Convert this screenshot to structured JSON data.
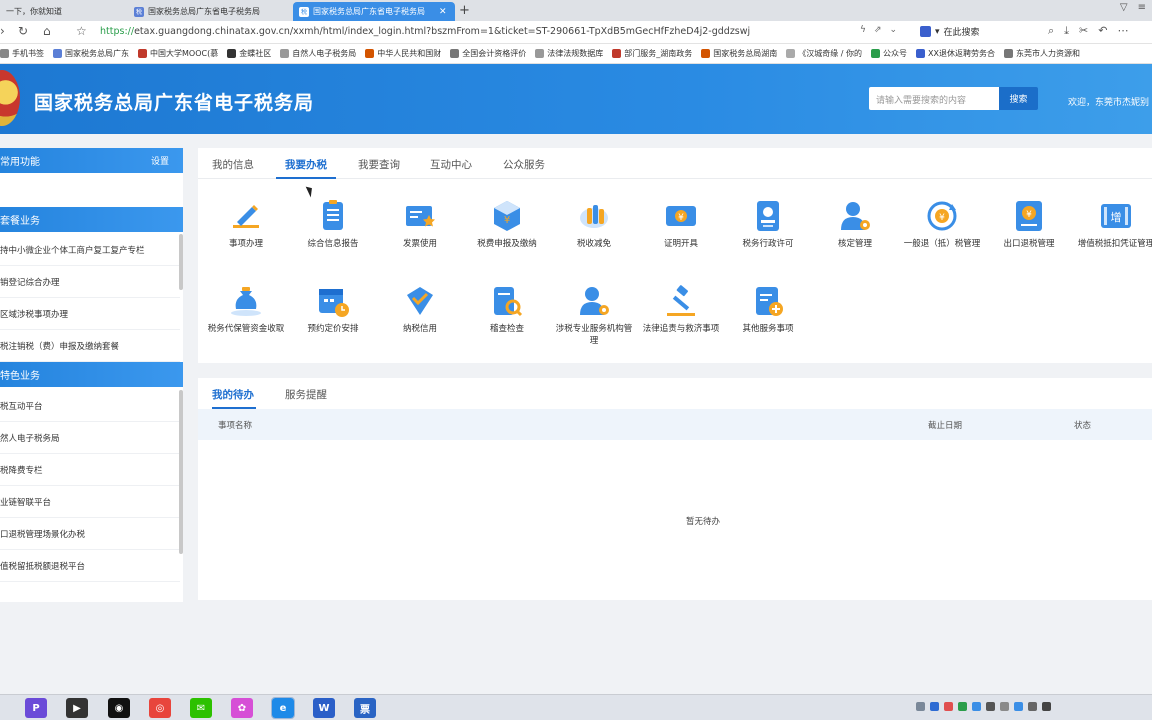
{
  "browser": {
    "tabs": [
      {
        "label": "一下，你就知道",
        "active": false
      },
      {
        "label": "国家税务总局广东省电子税务局",
        "active": false
      },
      {
        "label": "国家税务总局广东省电子税务局",
        "active": true
      }
    ],
    "tab_favicon": "税",
    "new_tab": "+",
    "url_proto": "https://",
    "url_rest": "etax.guangdong.chinatax.gov.cn/xxmh/html/index_login.html?bszmFrom=1&ticket=ST-290661-TpXdB5mGecHfFzheD4j2-gddzswj",
    "search_engine_label": "在此搜索",
    "bookmarks": [
      "手机书签",
      "国家税务总局广东",
      "中国大学MOOC(慕",
      "金蝶社区",
      "自然人电子税务局",
      "中华人民共和国财",
      "全国会计资格评价",
      "法律法规数据库",
      "部门服务_湖南政务",
      "国家税务总局湖南",
      "《汉城奇缘 / 你的",
      "公众号",
      "XX退休返聘劳务合",
      "东莞市人力资源和"
    ],
    "colors": {
      "active_tab": "#3a8ee6",
      "url_proto": "#2a9d4a"
    }
  },
  "header": {
    "title": "国家税务总局广东省电子税务局",
    "search_placeholder": "请输入需要搜索的内容",
    "search_button": "搜索",
    "welcome": "欢迎，东莞市杰妮别",
    "colors": {
      "header_blue": "#2a8be3",
      "search_button": "#1b6ec9"
    }
  },
  "sidebar": {
    "common": {
      "title": "常用功能",
      "setting": "设置"
    },
    "package": {
      "title": "套餐业务",
      "items": [
        "持中小微企业个体工商户复工复产专栏",
        "销登记综合办理",
        "区域涉税事项办理",
        "税注销税（费）申报及缴纳套餐"
      ]
    },
    "special": {
      "title": "特色业务",
      "items": [
        "税互动平台",
        "然人电子税务局",
        "税降费专栏",
        "业链智联平台",
        "口退税管理场景化办税",
        "值税留抵税额退税平台"
      ]
    }
  },
  "main": {
    "tabs": [
      "我的信息",
      "我要办税",
      "我要查询",
      "互动中心",
      "公众服务"
    ],
    "active_tab": "我要办税",
    "services": [
      {
        "label": "事项办理",
        "icon": "pencil-icon"
      },
      {
        "label": "综合信息报告",
        "icon": "document-list-icon"
      },
      {
        "label": "发票使用",
        "icon": "invoice-star-icon"
      },
      {
        "label": "税费申报及缴纳",
        "icon": "yuan-box-icon"
      },
      {
        "label": "税收减免",
        "icon": "coins-icon"
      },
      {
        "label": "证明开具",
        "icon": "yuan-ticket-icon"
      },
      {
        "label": "税务行政许可",
        "icon": "id-badge-icon"
      },
      {
        "label": "核定管理",
        "icon": "user-gear-icon"
      },
      {
        "label": "一般退（抵）税管理",
        "icon": "yuan-refresh-icon"
      },
      {
        "label": "出口退税管理",
        "icon": "yuan-book-icon"
      },
      {
        "label": "增值税抵扣凭证管理",
        "icon": "deduct-ticket-icon"
      },
      {
        "label": "税务代保管资金收取",
        "icon": "money-bag-icon"
      },
      {
        "label": "预约定价安排",
        "icon": "calendar-clock-icon"
      },
      {
        "label": "纳税信用",
        "icon": "shield-check-icon"
      },
      {
        "label": "稽查检查",
        "icon": "doc-search-icon"
      },
      {
        "label": "涉税专业服务机构管理",
        "icon": "user-gear-icon"
      },
      {
        "label": "法律追责与救济事项",
        "icon": "gavel-icon"
      },
      {
        "label": "其他服务事项",
        "icon": "clipboard-plus-icon"
      }
    ],
    "colors": {
      "primary": "#1e6fd0",
      "icon_blue": "#3a8ee6",
      "icon_orange": "#f5a623"
    }
  },
  "todo": {
    "tabs": [
      "我的待办",
      "服务提醒"
    ],
    "active_tab": "我的待办",
    "columns": [
      "事项名称",
      "截止日期",
      "状态"
    ],
    "empty_text": "暂无待办"
  },
  "taskbar": {
    "apps": [
      {
        "name": "app-p",
        "glyph": "P",
        "color": "#6b4bd8"
      },
      {
        "name": "app-video",
        "glyph": "▶",
        "color": "#333333"
      },
      {
        "name": "app-qq",
        "glyph": "◉",
        "color": "#111111"
      },
      {
        "name": "app-chrome",
        "glyph": "◎",
        "color": "#e8453c"
      },
      {
        "name": "app-wechat",
        "glyph": "✉",
        "color": "#2dc100"
      },
      {
        "name": "app-flower",
        "glyph": "✿",
        "color": "#d64fd6"
      },
      {
        "name": "app-browser",
        "glyph": "e",
        "color": "#1e8ae8"
      },
      {
        "name": "app-word",
        "glyph": "W",
        "color": "#2b5fc8"
      },
      {
        "name": "app-tax",
        "glyph": "票",
        "color": "#2a64c4"
      }
    ]
  }
}
